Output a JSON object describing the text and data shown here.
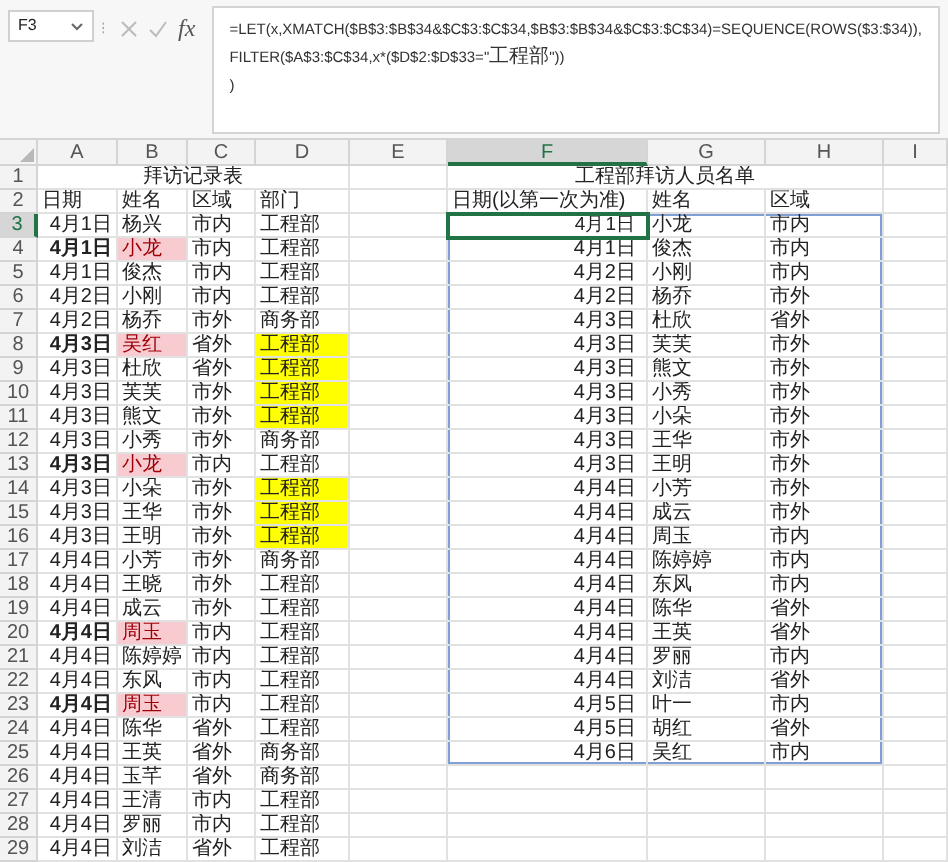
{
  "formula_bar": {
    "name_box": "F3",
    "function_label": "fx",
    "formula_lines": [
      "=LET(x,XMATCH($B$3:$B$34&$C$3:$C$34,$B$3:$B$34&$C$3:$C$34)=SEQUENCE(ROWS($3:$34)),",
      "FILTER($A$3:$C$34,x*($D$2:$D$33=\"工程部\"))",
      ")"
    ]
  },
  "columns": [
    {
      "label": "A",
      "selected": false
    },
    {
      "label": "B",
      "selected": false
    },
    {
      "label": "C",
      "selected": false
    },
    {
      "label": "D",
      "selected": false
    },
    {
      "label": "E",
      "selected": false
    },
    {
      "label": "F",
      "selected": true
    },
    {
      "label": "G",
      "selected": false
    },
    {
      "label": "H",
      "selected": false
    },
    {
      "label": "I",
      "selected": false
    }
  ],
  "rows": [
    {
      "label": "1",
      "selected": false
    },
    {
      "label": "2",
      "selected": false
    },
    {
      "label": "3",
      "selected": true
    },
    {
      "label": "4",
      "selected": false
    },
    {
      "label": "5",
      "selected": false
    },
    {
      "label": "6",
      "selected": false
    },
    {
      "label": "7",
      "selected": false
    },
    {
      "label": "8",
      "selected": false
    },
    {
      "label": "9",
      "selected": false
    },
    {
      "label": "10",
      "selected": false
    },
    {
      "label": "11",
      "selected": false
    },
    {
      "label": "12",
      "selected": false
    },
    {
      "label": "13",
      "selected": false
    },
    {
      "label": "14",
      "selected": false
    },
    {
      "label": "15",
      "selected": false
    },
    {
      "label": "16",
      "selected": false
    },
    {
      "label": "17",
      "selected": false
    },
    {
      "label": "18",
      "selected": false
    },
    {
      "label": "19",
      "selected": false
    },
    {
      "label": "20",
      "selected": false
    },
    {
      "label": "21",
      "selected": false
    },
    {
      "label": "22",
      "selected": false
    },
    {
      "label": "23",
      "selected": false
    },
    {
      "label": "24",
      "selected": false
    },
    {
      "label": "25",
      "selected": false
    },
    {
      "label": "26",
      "selected": false
    },
    {
      "label": "27",
      "selected": false
    },
    {
      "label": "28",
      "selected": false
    },
    {
      "label": "29",
      "selected": false
    }
  ],
  "visit_log": {
    "title": "拜访记录表",
    "headers": [
      "日期",
      "姓名",
      "区域",
      "部门"
    ],
    "records": [
      {
        "date": "4月1日",
        "name": "杨兴",
        "region": "市内",
        "department": "工程部",
        "duplicate": false,
        "department_highlighted": false
      },
      {
        "date": "4月1日",
        "name": "小龙",
        "region": "市内",
        "department": "工程部",
        "duplicate": true,
        "department_highlighted": false
      },
      {
        "date": "4月1日",
        "name": "俊杰",
        "region": "市内",
        "department": "工程部",
        "duplicate": false,
        "department_highlighted": false
      },
      {
        "date": "4月2日",
        "name": "小刚",
        "region": "市内",
        "department": "工程部",
        "duplicate": false,
        "department_highlighted": false
      },
      {
        "date": "4月2日",
        "name": "杨乔",
        "region": "市外",
        "department": "商务部",
        "duplicate": false,
        "department_highlighted": false
      },
      {
        "date": "4月3日",
        "name": "吴红",
        "region": "省外",
        "department": "工程部",
        "duplicate": true,
        "department_highlighted": true
      },
      {
        "date": "4月3日",
        "name": "杜欣",
        "region": "省外",
        "department": "工程部",
        "duplicate": false,
        "department_highlighted": true
      },
      {
        "date": "4月3日",
        "name": "芙芙",
        "region": "市外",
        "department": "工程部",
        "duplicate": false,
        "department_highlighted": true
      },
      {
        "date": "4月3日",
        "name": "熊文",
        "region": "市外",
        "department": "工程部",
        "duplicate": false,
        "department_highlighted": true
      },
      {
        "date": "4月3日",
        "name": "小秀",
        "region": "市外",
        "department": "商务部",
        "duplicate": false,
        "department_highlighted": false
      },
      {
        "date": "4月3日",
        "name": "小龙",
        "region": "市内",
        "department": "工程部",
        "duplicate": true,
        "department_highlighted": false
      },
      {
        "date": "4月3日",
        "name": "小朵",
        "region": "市外",
        "department": "工程部",
        "duplicate": false,
        "department_highlighted": true
      },
      {
        "date": "4月3日",
        "name": "王华",
        "region": "市外",
        "department": "工程部",
        "duplicate": false,
        "department_highlighted": true
      },
      {
        "date": "4月3日",
        "name": "王明",
        "region": "市外",
        "department": "工程部",
        "duplicate": false,
        "department_highlighted": true
      },
      {
        "date": "4月4日",
        "name": "小芳",
        "region": "市外",
        "department": "商务部",
        "duplicate": false,
        "department_highlighted": false
      },
      {
        "date": "4月4日",
        "name": "王晓",
        "region": "市外",
        "department": "工程部",
        "duplicate": false,
        "department_highlighted": false
      },
      {
        "date": "4月4日",
        "name": "成云",
        "region": "市外",
        "department": "工程部",
        "duplicate": false,
        "department_highlighted": false
      },
      {
        "date": "4月4日",
        "name": "周玉",
        "region": "市内",
        "department": "工程部",
        "duplicate": true,
        "department_highlighted": false
      },
      {
        "date": "4月4日",
        "name": "陈婷婷",
        "region": "市内",
        "department": "工程部",
        "duplicate": false,
        "department_highlighted": false
      },
      {
        "date": "4月4日",
        "name": "东风",
        "region": "市内",
        "department": "工程部",
        "duplicate": false,
        "department_highlighted": false
      },
      {
        "date": "4月4日",
        "name": "周玉",
        "region": "市内",
        "department": "工程部",
        "duplicate": true,
        "department_highlighted": false
      },
      {
        "date": "4月4日",
        "name": "陈华",
        "region": "省外",
        "department": "工程部",
        "duplicate": false,
        "department_highlighted": false
      },
      {
        "date": "4月4日",
        "name": "王英",
        "region": "省外",
        "department": "商务部",
        "duplicate": false,
        "department_highlighted": false
      },
      {
        "date": "4月4日",
        "name": "玉芊",
        "region": "省外",
        "department": "商务部",
        "duplicate": false,
        "department_highlighted": false
      },
      {
        "date": "4月4日",
        "name": "王清",
        "region": "市内",
        "department": "工程部",
        "duplicate": false,
        "department_highlighted": false
      },
      {
        "date": "4月4日",
        "name": "罗丽",
        "region": "市内",
        "department": "工程部",
        "duplicate": false,
        "department_highlighted": false
      },
      {
        "date": "4月4日",
        "name": "刘洁",
        "region": "省外",
        "department": "工程部",
        "duplicate": false,
        "department_highlighted": false
      }
    ]
  },
  "engineering_visitors": {
    "title": "工程部拜访人员名单",
    "headers": [
      "日期(以第一次为准)",
      "姓名",
      "区域"
    ],
    "records": [
      {
        "date": "4月1日",
        "name": "小龙",
        "region": "市内",
        "selected": true
      },
      {
        "date": "4月1日",
        "name": "俊杰",
        "region": "市内",
        "selected": false
      },
      {
        "date": "4月2日",
        "name": "小刚",
        "region": "市内",
        "selected": false
      },
      {
        "date": "4月2日",
        "name": "杨乔",
        "region": "市外",
        "selected": false
      },
      {
        "date": "4月3日",
        "name": "杜欣",
        "region": "省外",
        "selected": false
      },
      {
        "date": "4月3日",
        "name": "芙芙",
        "region": "市外",
        "selected": false
      },
      {
        "date": "4月3日",
        "name": "熊文",
        "region": "市外",
        "selected": false
      },
      {
        "date": "4月3日",
        "name": "小秀",
        "region": "市外",
        "selected": false
      },
      {
        "date": "4月3日",
        "name": "小朵",
        "region": "市外",
        "selected": false
      },
      {
        "date": "4月3日",
        "name": "王华",
        "region": "市外",
        "selected": false
      },
      {
        "date": "4月3日",
        "name": "王明",
        "region": "市外",
        "selected": false
      },
      {
        "date": "4月4日",
        "name": "小芳",
        "region": "市外",
        "selected": false
      },
      {
        "date": "4月4日",
        "name": "成云",
        "region": "市外",
        "selected": false
      },
      {
        "date": "4月4日",
        "name": "周玉",
        "region": "市内",
        "selected": false
      },
      {
        "date": "4月4日",
        "name": "陈婷婷",
        "region": "市内",
        "selected": false
      },
      {
        "date": "4月4日",
        "name": "东风",
        "region": "市内",
        "selected": false
      },
      {
        "date": "4月4日",
        "name": "陈华",
        "region": "省外",
        "selected": false
      },
      {
        "date": "4月4日",
        "name": "王英",
        "region": "省外",
        "selected": false
      },
      {
        "date": "4月4日",
        "name": "罗丽",
        "region": "市内",
        "selected": false
      },
      {
        "date": "4月4日",
        "name": "刘洁",
        "region": "省外",
        "selected": false
      },
      {
        "date": "4月5日",
        "name": "叶一",
        "region": "市内",
        "selected": false
      },
      {
        "date": "4月5日",
        "name": "胡红",
        "region": "省外",
        "selected": false
      },
      {
        "date": "4月6日",
        "name": "吴红",
        "region": "市内",
        "selected": false
      }
    ]
  }
}
